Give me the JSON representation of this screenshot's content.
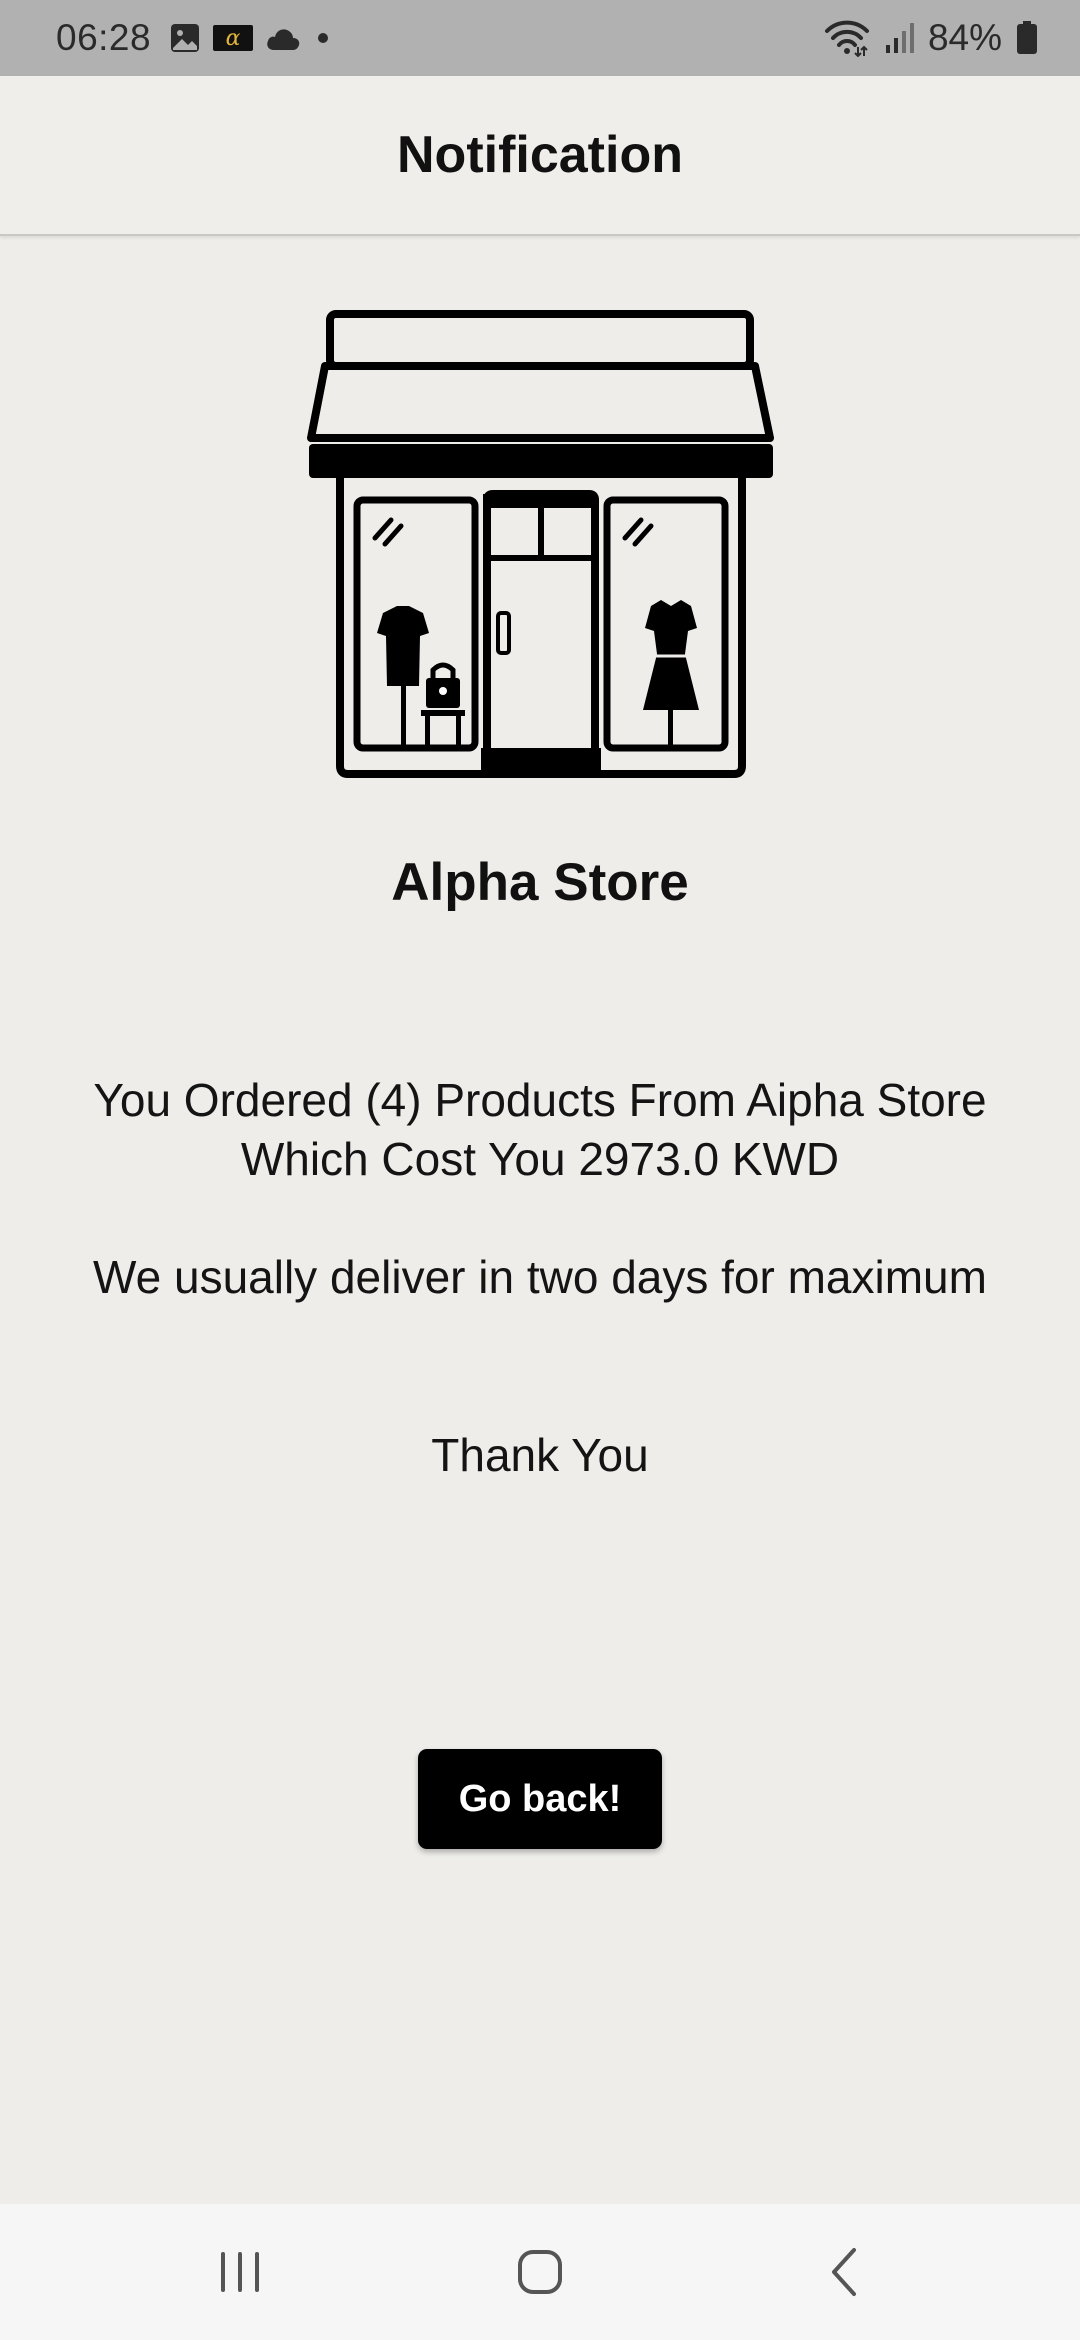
{
  "status_bar": {
    "time": "06:28",
    "notification_icons": [
      "gallery-icon",
      "alpha-app-icon",
      "cloud-icon",
      "dot-icon"
    ],
    "battery": "84%",
    "system_icons": [
      "wifi-icon",
      "signal-icon",
      "battery-icon"
    ]
  },
  "app_bar": {
    "title": "Notification"
  },
  "store": {
    "illustration_icon": "storefront-icon",
    "name": "Alpha Store"
  },
  "message": {
    "order_summary": "You Ordered (4) Products From Aipha Store Which Cost You 2973.0 KWD",
    "delivery_note": "We usually deliver in two days for maximum",
    "thanks": "Thank You"
  },
  "actions": {
    "go_back_label": "Go back!"
  },
  "nav_bar": {
    "icons": [
      "recents-icon",
      "home-icon",
      "back-icon"
    ]
  },
  "colors": {
    "background": "#EEEDEA",
    "status_bar": "#B1B1B1",
    "button": "#000000",
    "button_text": "#FFFFFF",
    "nav_bar": "#F6F6F6"
  }
}
